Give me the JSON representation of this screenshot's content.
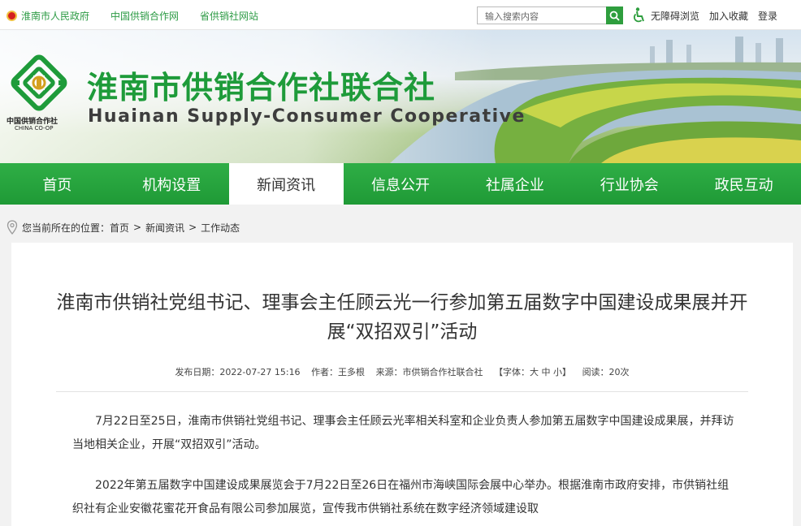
{
  "top": {
    "links": [
      "淮南市人民政府",
      "中国供销合作网",
      "省供销社网站"
    ],
    "search_placeholder": "输入搜索内容",
    "accessibility": "无障碍浏览",
    "favorite": "加入收藏",
    "login": "登录"
  },
  "banner": {
    "title": "淮南市供销合作社联合社",
    "subtitle": "Huainan Supply-Consumer Cooperative",
    "logo_text": "中国供销合作社",
    "logo_text_en": "CHINA CO-OP"
  },
  "nav": [
    {
      "label": "首页"
    },
    {
      "label": "机构设置"
    },
    {
      "label": "新闻资讯"
    },
    {
      "label": "信息公开"
    },
    {
      "label": "社属企业"
    },
    {
      "label": "行业协会"
    },
    {
      "label": "政民互动"
    }
  ],
  "breadcrumb": {
    "prefix": "您当前所在的位置：",
    "items": [
      "首页",
      "新闻资讯",
      "工作动态"
    ],
    "sep": ">"
  },
  "article": {
    "title": "淮南市供销社党组书记、理事会主任顾云光一行参加第五届数字中国建设成果展并开展“双招双引”活动",
    "meta": {
      "date": "发布日期：2022-07-27 15:16",
      "author": "作者：王多根",
      "source": "来源：市供销合作社联合社",
      "font": "【字体：大 中 小】",
      "views": "阅读：20次"
    },
    "paragraphs": [
      "7月22日至25日，淮南市供销社党组书记、理事会主任顾云光率相关科室和企业负责人参加第五届数字中国建设成果展，并拜访当地相关企业，开展“双招双引”活动。",
      "2022年第五届数字中国建设成果展览会于7月22日至26日在福州市海峡国际会展中心举办。根据淮南市政府安排，市供销社组织社有企业安徽花蜜花开食品有限公司参加展览，宣传我市供销社系统在数字经济领域建设取"
    ]
  },
  "colors": {
    "brand_green": "#1e9b3a",
    "nav_green": "#2fae46"
  }
}
